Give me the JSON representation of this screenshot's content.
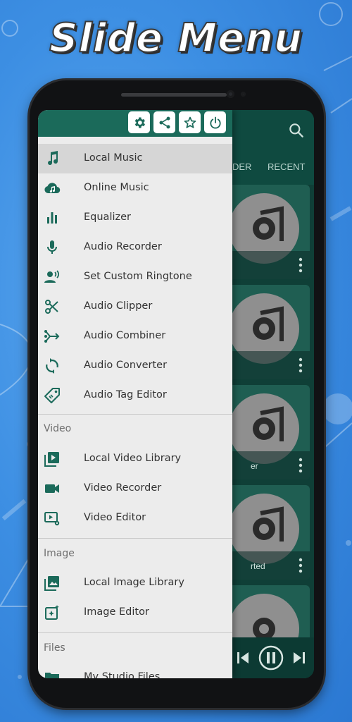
{
  "promo": {
    "title": "Slide Menu"
  },
  "app": {
    "tabs": [
      "DER",
      "RECENT"
    ],
    "cards": [
      {
        "caption": ""
      },
      {
        "caption": ""
      },
      {
        "caption": "er"
      },
      {
        "caption": "rted"
      },
      {
        "caption": ""
      }
    ]
  },
  "drawer": {
    "header_buttons": [
      "settings-icon",
      "share-icon",
      "star-icon",
      "power-icon"
    ],
    "audio_items": [
      {
        "label": "Local Music",
        "icon": "music-note-icon",
        "active": true
      },
      {
        "label": "Online Music",
        "icon": "cloud-music-icon"
      },
      {
        "label": "Equalizer",
        "icon": "equalizer-icon"
      },
      {
        "label": "Audio Recorder",
        "icon": "microphone-icon"
      },
      {
        "label": "Set Custom Ringtone",
        "icon": "ringtone-icon"
      },
      {
        "label": "Audio Clipper",
        "icon": "scissors-icon"
      },
      {
        "label": "Audio Combiner",
        "icon": "merge-icon"
      },
      {
        "label": "Audio Converter",
        "icon": "convert-icon"
      },
      {
        "label": "Audio Tag Editor",
        "icon": "tag-icon"
      }
    ],
    "sections": {
      "video": "Video",
      "image": "Image",
      "files": "Files"
    },
    "video_items": [
      {
        "label": "Local Video Library",
        "icon": "video-library-icon"
      },
      {
        "label": "Video Recorder",
        "icon": "video-camera-icon"
      },
      {
        "label": "Video Editor",
        "icon": "video-settings-icon"
      }
    ],
    "image_items": [
      {
        "label": "Local Image Library",
        "icon": "image-library-icon"
      },
      {
        "label": "Image Editor",
        "icon": "image-edit-icon"
      }
    ],
    "files_items": [
      {
        "label": "My Studio Files",
        "icon": "folder-icon"
      }
    ]
  },
  "colors": {
    "accent": "#1b6a5a",
    "icon": "#1b6a5a",
    "drawer_bg": "#ececec",
    "background": "#3d8fe3"
  }
}
